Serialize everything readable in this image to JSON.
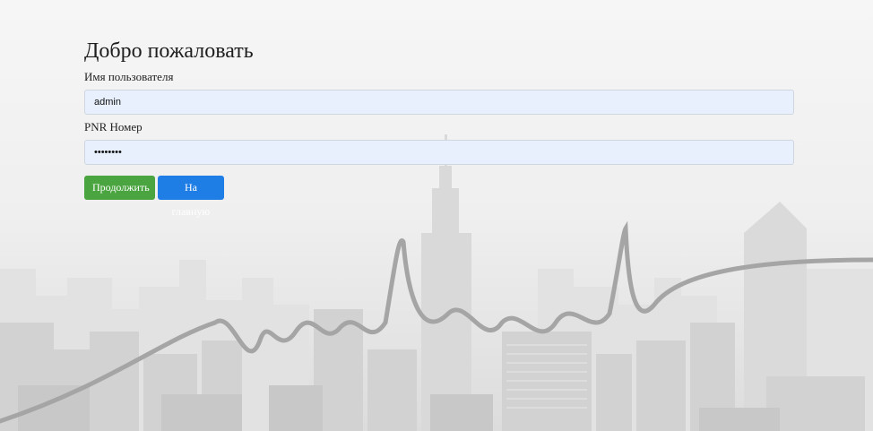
{
  "title": "Добро пожаловать",
  "username": {
    "label": "Имя пользователя",
    "value": "admin"
  },
  "pnr": {
    "label": "PNR Номер",
    "masked_value": "••••••••"
  },
  "buttons": {
    "continue": "Продолжить",
    "home": "На главную"
  },
  "colors": {
    "continue_button": "#4aa43f",
    "home_button": "#1f7de6",
    "field_background": "#e8f0fe"
  }
}
